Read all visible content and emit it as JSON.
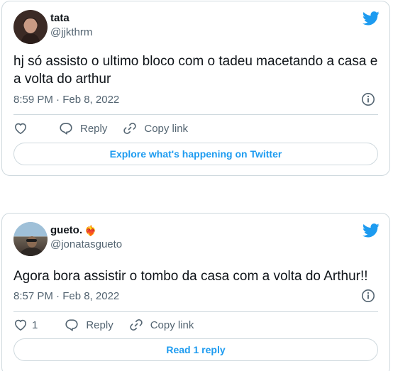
{
  "tweets": [
    {
      "display_name": "tata",
      "emoji": "",
      "handle": "@jjkthrm",
      "text": "hj só assisto o ultimo bloco com o tadeu macetando a casa e a volta do arthur",
      "timestamp": "8:59 PM · Feb 8, 2022",
      "like_count": "",
      "reply_label": "Reply",
      "copy_link_label": "Copy link",
      "cta_label": "Explore what's happening on Twitter"
    },
    {
      "display_name": "gueto.",
      "emoji": "❤️‍🔥",
      "handle": "@jonatasgueto",
      "text": "Agora bora assistir o tombo da casa com a volta do Arthur!!",
      "timestamp": "8:57 PM · Feb 8, 2022",
      "like_count": "1",
      "reply_label": "Reply",
      "copy_link_label": "Copy link",
      "cta_label": "Read 1 reply"
    }
  ],
  "icons": {
    "brand": "twitter-bird-icon",
    "info": "info-icon",
    "like": "heart-icon",
    "reply": "speech-bubble-icon",
    "copy_link": "link-icon"
  },
  "colors": {
    "brand": "#1d9bf0",
    "text": "#0f1419",
    "muted": "#536471",
    "border": "#cfd9de"
  }
}
